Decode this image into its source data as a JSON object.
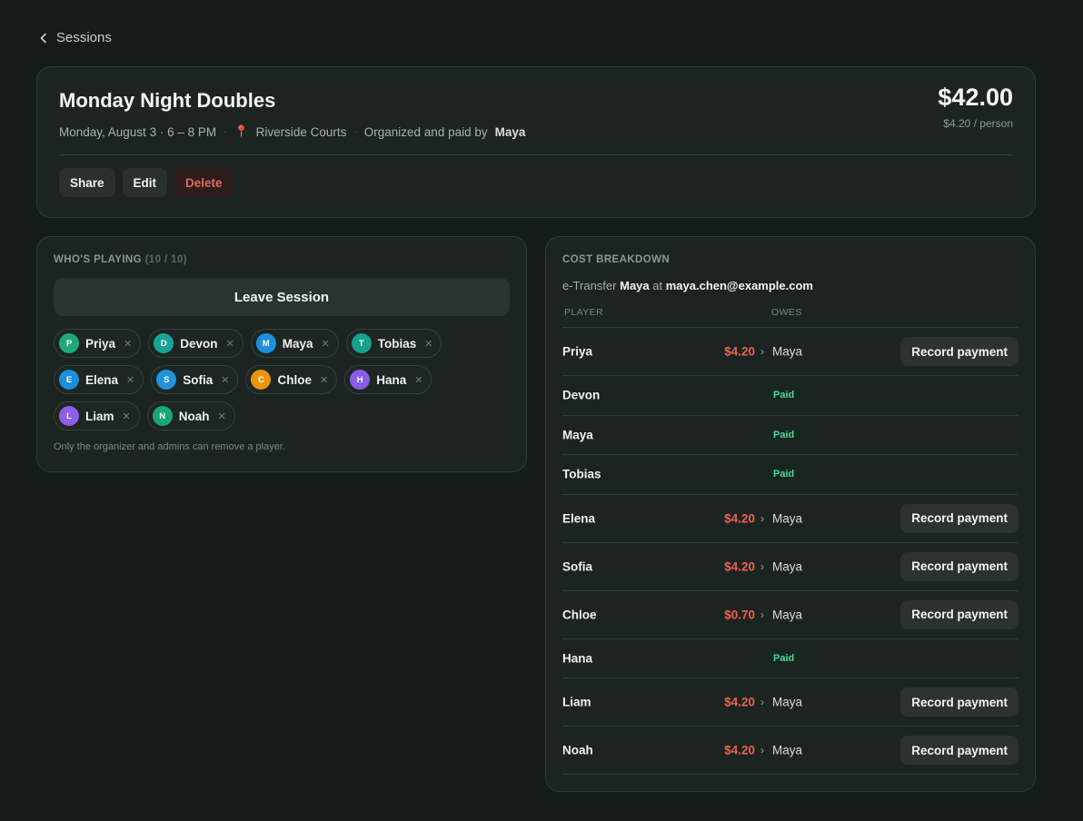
{
  "nav": {
    "back_label": "Sessions"
  },
  "session": {
    "title": "Monday Night Doubles",
    "date_time": "Monday, August 3 · 6 – 8 PM",
    "location": "Riverside Courts",
    "organizer_prefix": "Organized and paid by",
    "organizer": "Maya",
    "total": "$42.00",
    "per_person": "$4.20 / person",
    "actions": {
      "share": "Share",
      "edit": "Edit",
      "delete": "Delete"
    }
  },
  "players_section": {
    "heading": "WHO'S PLAYING",
    "count": "(10 / 10)",
    "leave_label": "Leave Session",
    "note": "Only the organizer and admins can remove a player.",
    "players": [
      {
        "initial": "P",
        "name": "Priya",
        "color": "#1fa97a"
      },
      {
        "initial": "D",
        "name": "Devon",
        "color": "#1aa39a"
      },
      {
        "initial": "M",
        "name": "Maya",
        "color": "#1d8fe0"
      },
      {
        "initial": "T",
        "name": "Tobias",
        "color": "#16a38e"
      },
      {
        "initial": "E",
        "name": "Elena",
        "color": "#1b8fd8"
      },
      {
        "initial": "S",
        "name": "Sofia",
        "color": "#1e94dc"
      },
      {
        "initial": "C",
        "name": "Chloe",
        "color": "#e8960f"
      },
      {
        "initial": "H",
        "name": "Hana",
        "color": "#8b5ce6"
      },
      {
        "initial": "L",
        "name": "Liam",
        "color": "#8e5ee8"
      },
      {
        "initial": "N",
        "name": "Noah",
        "color": "#1aa57a"
      }
    ]
  },
  "cost_section": {
    "heading": "COST BREAKDOWN",
    "etransfer_prefix": "e-Transfer",
    "etransfer_to": "Maya",
    "etransfer_at": "at",
    "etransfer_email": "maya.chen@example.com",
    "col_player": "PLAYER",
    "col_owes": "OWES",
    "paid_label": "Paid",
    "record_label": "Record payment",
    "rows": [
      {
        "name": "Priya",
        "status": "owes",
        "amount": "$4.20",
        "to": "Maya"
      },
      {
        "name": "Devon",
        "status": "paid"
      },
      {
        "name": "Maya",
        "status": "paid"
      },
      {
        "name": "Tobias",
        "status": "paid"
      },
      {
        "name": "Elena",
        "status": "owes",
        "amount": "$4.20",
        "to": "Maya"
      },
      {
        "name": "Sofia",
        "status": "owes",
        "amount": "$4.20",
        "to": "Maya"
      },
      {
        "name": "Chloe",
        "status": "owes",
        "amount": "$0.70",
        "to": "Maya"
      },
      {
        "name": "Hana",
        "status": "paid"
      },
      {
        "name": "Liam",
        "status": "owes",
        "amount": "$4.20",
        "to": "Maya"
      },
      {
        "name": "Noah",
        "status": "owes",
        "amount": "$4.20",
        "to": "Maya"
      }
    ]
  },
  "colors": {
    "background": "#141c19",
    "card": "#1b2421",
    "owed": "#ef5f4e",
    "paid": "#4fd69b"
  }
}
